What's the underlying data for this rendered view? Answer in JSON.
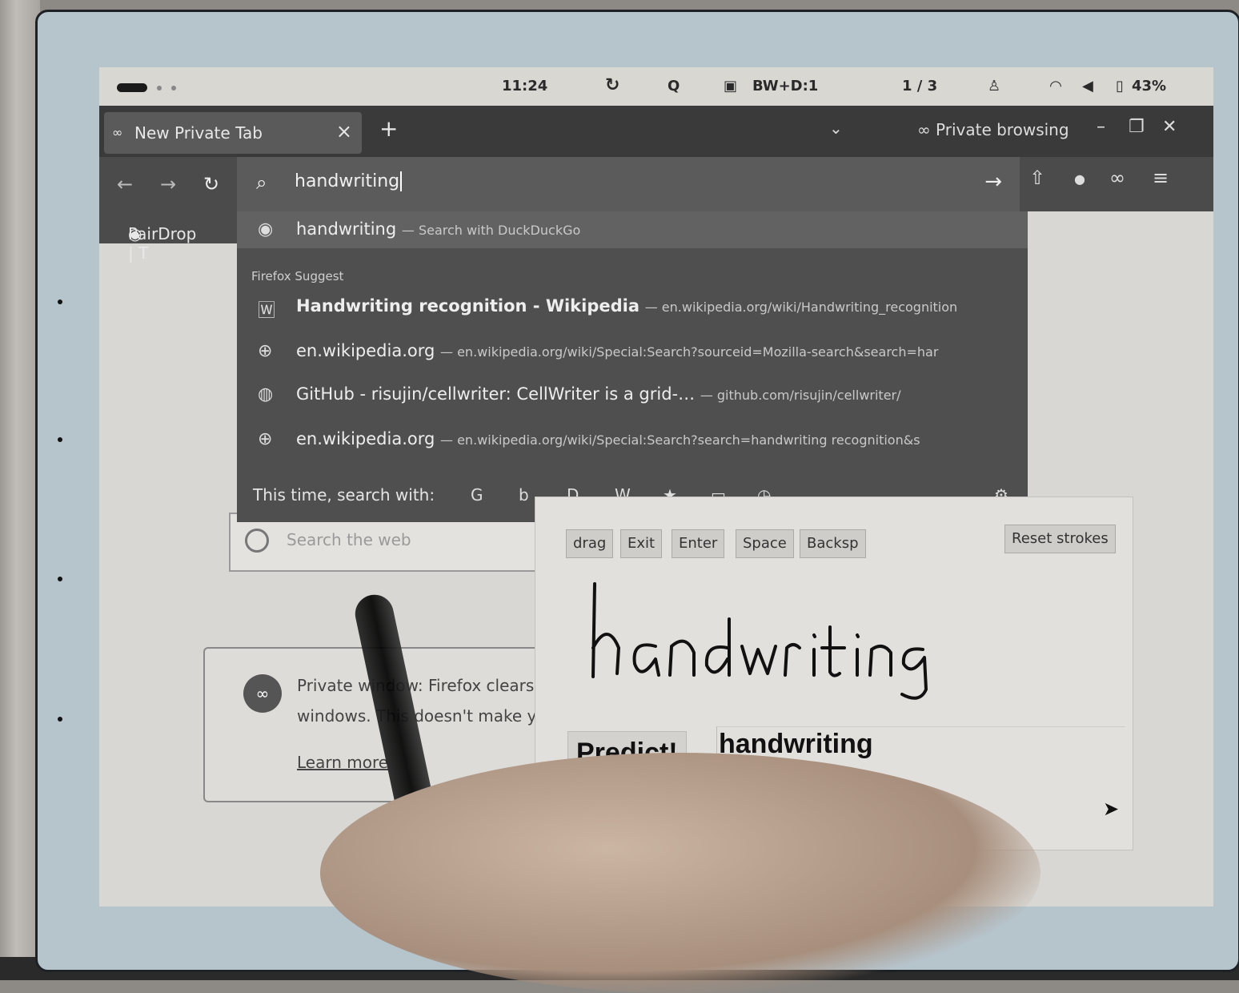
{
  "status_bar": {
    "time": "11:24",
    "refresh_icon": "refresh-icon",
    "quick_label": "Q",
    "mode": "BW+D:1",
    "page": "1 / 3",
    "battery": "43%"
  },
  "tabs": [
    {
      "label": "New Private Tab",
      "close": "×"
    }
  ],
  "tabstrip": {
    "new_tab": "+",
    "list_all": "⌄",
    "private_label": "Private browsing",
    "minimize": "–",
    "restore": "❐",
    "close": "✕"
  },
  "navbar": {
    "back": "←",
    "forward": "→",
    "reload": "↻",
    "url_value": "handwriting",
    "go": "→"
  },
  "bookmarks": {
    "item": "PairDrop | T"
  },
  "dropdown": {
    "top_suggestion": {
      "query": "handwriting",
      "engine": "— Search with DuckDuckGo"
    },
    "group_header": "Firefox Suggest",
    "items": [
      {
        "title": "Handwriting recognition - Wikipedia",
        "url": "— en.wikipedia.org/wiki/Handwriting_recognition",
        "icon": "W"
      },
      {
        "title": "en.wikipedia.org",
        "url": "— en.wikipedia.org/wiki/Special:Search?sourceid=Mozilla-search&search=har",
        "icon": "globe"
      },
      {
        "title": "GitHub - risujin/cellwriter: CellWriter is a grid-…",
        "url": "— github.com/risujin/cellwriter/",
        "icon": "github"
      },
      {
        "title": "en.wikipedia.org",
        "url": "— en.wikipedia.org/wiki/Special:Search?search=handwriting recognition&s",
        "icon": "globe"
      }
    ],
    "footer_label": "This time, search with:",
    "engines": [
      "G",
      "b",
      "D",
      "W",
      "★",
      "▭",
      "◷"
    ],
    "settings": "⚙"
  },
  "page": {
    "search_placeholder": "Search the web",
    "private_line1": "Private window: Firefox clears",
    "private_line2": "windows. This doesn't make y",
    "learn_more": "Learn more"
  },
  "handwriting_panel": {
    "buttons": [
      "drag",
      "Exit",
      "Enter",
      "Space",
      "Backsp"
    ],
    "reset": "Reset strokes",
    "ink_text": "handwriting",
    "predict": "Predict!",
    "prediction": "handwriting"
  }
}
